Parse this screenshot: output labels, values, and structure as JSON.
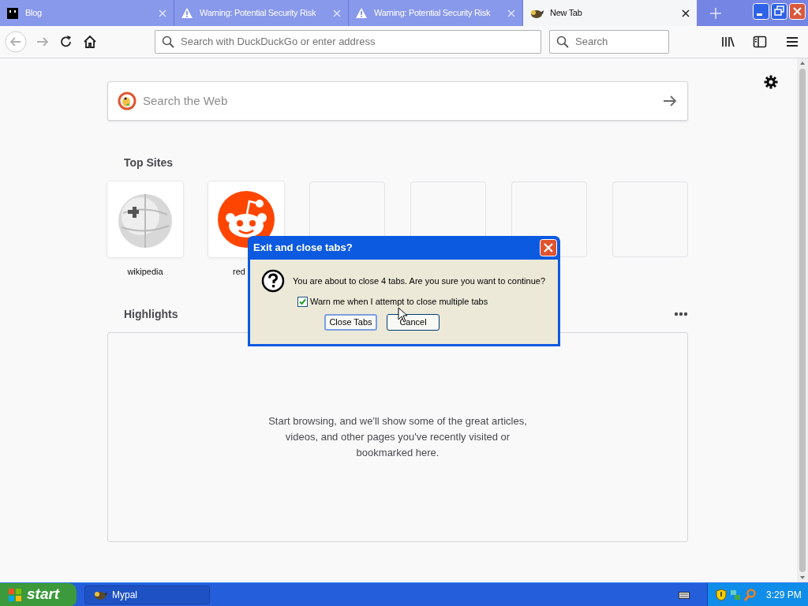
{
  "tabs": [
    {
      "title": "Blog",
      "kind": "blackbox",
      "selected": false
    },
    {
      "title": "Warning: Potential Security Risk",
      "kind": "warning",
      "selected": false
    },
    {
      "title": "Warning: Potential Security Risk",
      "kind": "warning",
      "selected": false
    },
    {
      "title": "New Tab",
      "kind": "bird",
      "selected": true
    }
  ],
  "toolbar": {
    "address_placeholder": "Search with DuckDuckGo or enter address",
    "search_placeholder": "Search"
  },
  "new_tab": {
    "search_placeholder": "Search the Web",
    "top_sites_heading": "Top Sites",
    "top_sites": [
      {
        "label": "wikipedia",
        "kind": "wikipedia"
      },
      {
        "label": "red",
        "kind": "reddit"
      },
      {
        "kind": "empty"
      },
      {
        "kind": "empty"
      },
      {
        "kind": "empty"
      },
      {
        "kind": "empty"
      }
    ],
    "highlights_heading": "Highlights",
    "highlights_message": "Start browsing, and we'll show some of the great articles, videos, and other pages you've recently visited or bookmarked here."
  },
  "dialog": {
    "title": "Exit and close tabs?",
    "message": "You are about to close 4 tabs. Are you sure you want to continue?",
    "checkbox": {
      "label": "Warn me when I attempt to close multiple tabs",
      "checked": true
    },
    "buttons": [
      {
        "label": "Close Tabs",
        "focused": true
      },
      {
        "label": "Cancel",
        "focused": false
      }
    ]
  },
  "taskbar": {
    "start": "start",
    "task": "Mypal",
    "clock": "3:29 PM"
  }
}
